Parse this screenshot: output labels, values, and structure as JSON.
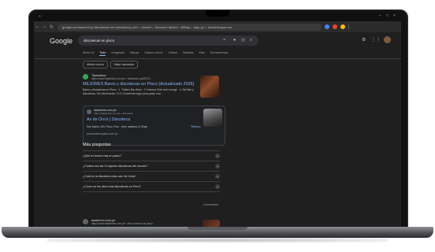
{
  "browser": {
    "url": "google.com/search?q=discotecas+en+pisco&sca_esv=...&sxsrf=...&source=hp&ei=...&iflsig=...&gs_lp=...&sclient=gws-wiz"
  },
  "google": {
    "logo": "Google",
    "query": "discotecas en pisco",
    "tabs": [
      "Modo IA",
      "Todo",
      "Imágenes",
      "Mapas",
      "Videos cortos",
      "Videos",
      "Noticias",
      "Más"
    ],
    "tools_label": "Herramientas",
    "chips": [
      "Abierto ahora",
      "Mejor valorados"
    ]
  },
  "result1": {
    "site": "Tripadvisor",
    "url": "https://www.tripadvisor.com.pe › Attractions-g445742-...",
    "title": "MEJORES Bares y discotecas en Pisco (Actualizado 2026)",
    "snippet": "Bares y discotecas en Pisco · 1. Tinkers Bar Bowl · 2. Kamma Club and Lounge · 4. Afu Bar y discotecas. Sin información / 5.0 / Excelente lugar para pasar una ..."
  },
  "card": {
    "site": "aladerinto.com.pe",
    "url": "https://aladerinto.com.pe › discoteca",
    "title": "As de Oro's | Discoteca",
    "address": "San Martín 403, Pisco, Perú · Abre mañana 11:30am ·",
    "phone": "Teléfono",
    "extra": "www.asdeorospisco.com.pe"
  },
  "paa": {
    "heading": "Más preguntas",
    "questions": [
      "¿Qué es bueno hay en pisco?",
      "¿Cuáles son las 3 mejores discotecas del mundo?",
      "¿Cuál es la discoteca más caro de Lima?",
      "¿Cómo se les dice a las discotecas en Perú?"
    ],
    "feedback": "Comentarios"
  },
  "result2": {
    "site": "aladerinto.com.pe",
    "url": "https://www.aladerinto.com.pe › club-nocturno-as-pisco"
  },
  "colors": {
    "link": "#8ab4f8",
    "page_bg": "#1f1f1f"
  }
}
